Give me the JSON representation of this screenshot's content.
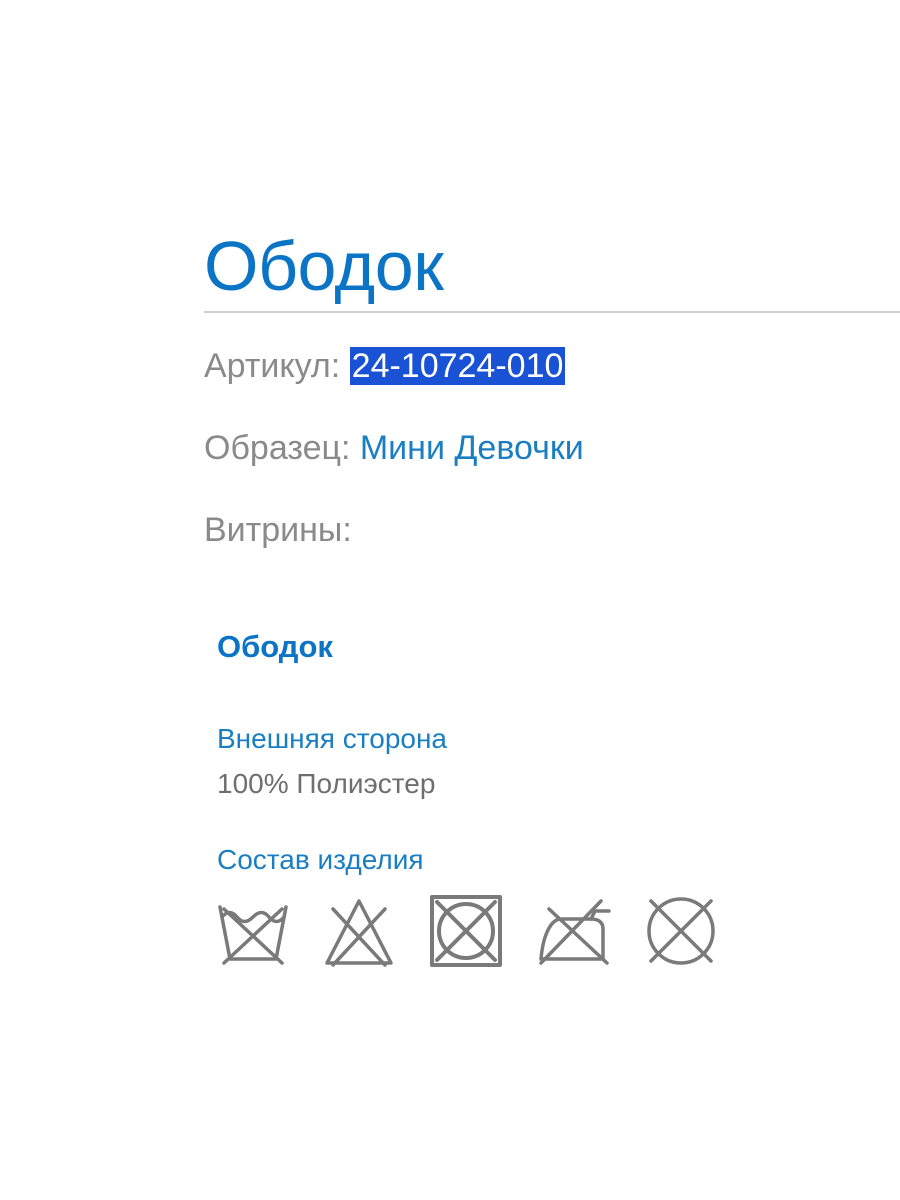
{
  "product": {
    "title": "Ободок"
  },
  "meta": {
    "article_label": "Артикул:",
    "article_value": "24-10724-010",
    "sample_label": "Образец:",
    "sample_value": "Мини Девочки",
    "showcases_label": "Витрины:"
  },
  "details": {
    "section_title": "Ободок",
    "outer_side_label": "Внешняя сторона",
    "outer_side_value": "100% Полиэстер",
    "composition_label": "Состав изделия"
  },
  "care_icons": [
    "do-not-wash-icon",
    "do-not-bleach-icon",
    "do-not-tumble-dry-icon",
    "do-not-iron-icon",
    "do-not-dry-clean-icon"
  ],
  "colors": {
    "accent": "#0b74c4",
    "link": "#1a7fc2",
    "label_gray": "#8a8a8a",
    "selection": "#1a52d6",
    "icon_gray": "#7a7a7a"
  }
}
